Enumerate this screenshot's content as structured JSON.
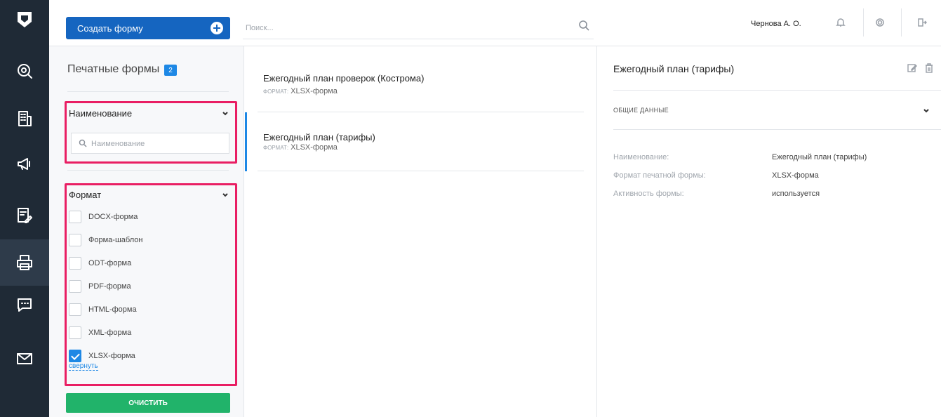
{
  "topbar": {
    "create_label": "Создать форму",
    "search_placeholder": "Поиск...",
    "user_name": "Чернова А. О."
  },
  "rail": {
    "icons": [
      "logo-icon",
      "search-gauge-icon",
      "building-icon",
      "megaphone-icon",
      "edit-doc-icon",
      "printer-icon",
      "chat-icon",
      "mail-icon"
    ],
    "active": "printer-icon"
  },
  "filters": {
    "title": "Печатные формы",
    "count": "2",
    "name_section": {
      "label": "Наименование",
      "placeholder": "Наименование"
    },
    "format_section": {
      "label": "Формат",
      "options": [
        {
          "label": "DOCX-форма",
          "checked": false
        },
        {
          "label": "Форма-шаблон",
          "checked": false
        },
        {
          "label": "ODT-форма",
          "checked": false
        },
        {
          "label": "PDF-форма",
          "checked": false
        },
        {
          "label": "HTML-форма",
          "checked": false
        },
        {
          "label": "XML-форма",
          "checked": false
        },
        {
          "label": "XLSX-форма",
          "checked": true
        }
      ],
      "collapse_label": "свернуть"
    },
    "clear_label": "ОЧИСТИТЬ"
  },
  "list": {
    "items": [
      {
        "title": "Ежегодный план проверок (Кострома)",
        "format_key": "формат:",
        "format_value": "XLSX-форма",
        "selected": false
      },
      {
        "title": "Ежегодный план (тарифы)",
        "format_key": "формат:",
        "format_value": "XLSX-форма",
        "selected": true
      }
    ]
  },
  "details": {
    "title": "Ежегодный план (тарифы)",
    "section": "ОБЩИЕ ДАННЫЕ",
    "rows": [
      {
        "key": "Наименование:",
        "value": "Ежегодный план (тарифы)"
      },
      {
        "key": "Формат печатной формы:",
        "value": "XLSX-форма"
      },
      {
        "key": "Активность формы:",
        "value": "используется"
      }
    ]
  },
  "colors": {
    "primary": "#1565c0",
    "accent": "#1e88e5",
    "highlight": "#e91e63",
    "success": "#21b36a",
    "rail": "#1f2a36"
  }
}
